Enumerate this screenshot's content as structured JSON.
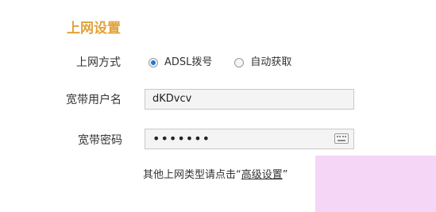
{
  "title": "上网设置",
  "connection_type": {
    "label": "上网方式",
    "options": [
      {
        "label": "ADSL拨号",
        "selected": true
      },
      {
        "label": "自动获取",
        "selected": false
      }
    ]
  },
  "username": {
    "label": "宽带用户名",
    "value": "dKDvcv"
  },
  "password": {
    "label": "宽带密码",
    "masked_value": "•••••••"
  },
  "hint": {
    "prefix": "其他上网类型请点击“",
    "link": "高级设置",
    "suffix": "”"
  },
  "colors": {
    "title": "#e2a23a",
    "radio_selected": "#1e78d6",
    "corner_overlay": "#f5d6f6"
  },
  "icons": {
    "keyboard": "keyboard-icon"
  }
}
